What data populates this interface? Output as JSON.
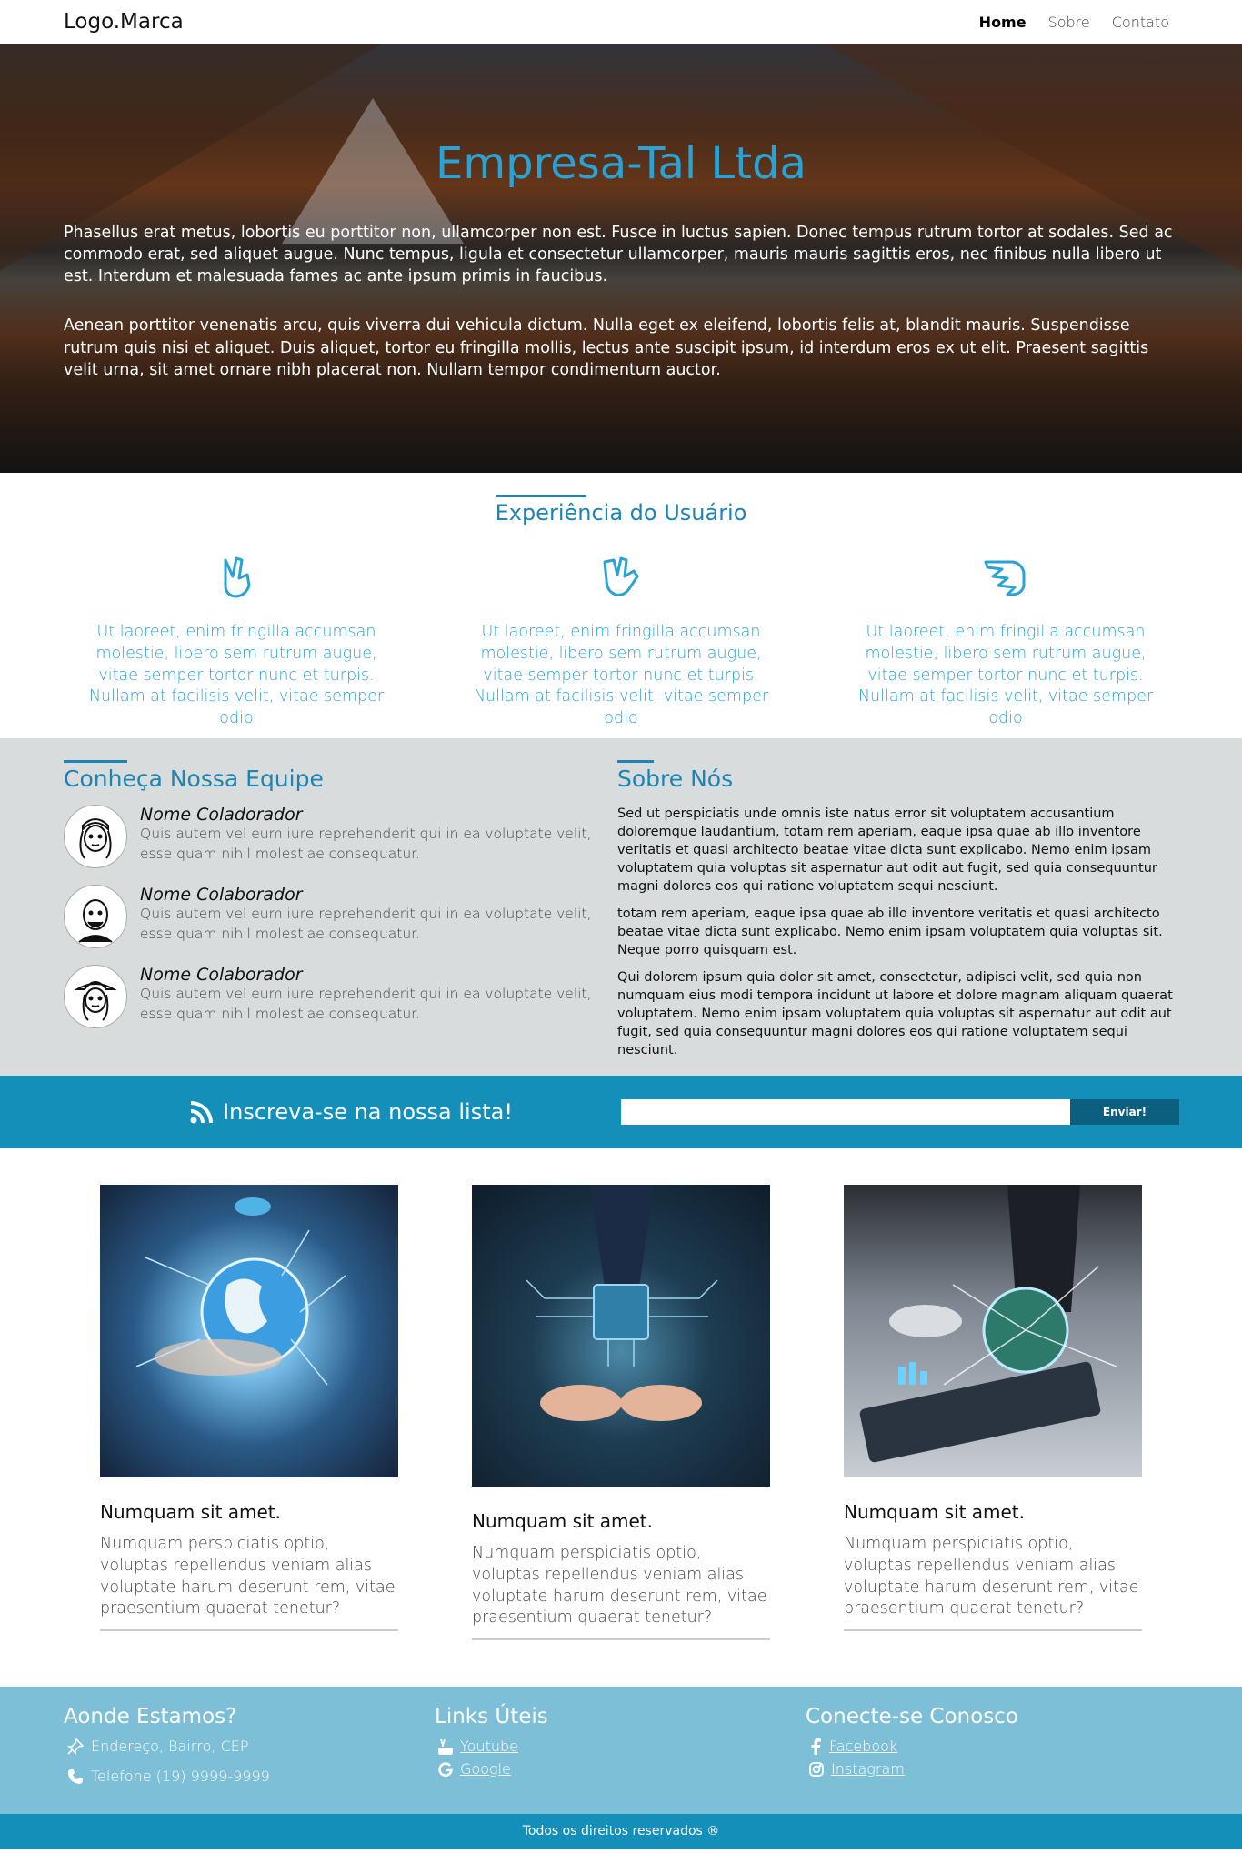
{
  "nav": {
    "logo": "Logo.Marca",
    "items": [
      {
        "label": "Home",
        "active": true
      },
      {
        "label": "Sobre",
        "active": false
      },
      {
        "label": "Contato",
        "active": false
      }
    ]
  },
  "hero": {
    "title": "Empresa-Tal Ltda",
    "paragraphs": [
      "Phasellus erat metus, lobortis eu porttitor non, ullamcorper non est. Fusce in luctus sapien. Donec tempus rutrum tortor at sodales. Sed ac commodo erat, sed aliquet augue. Nunc tempus, ligula et consectetur ullamcorper, mauris mauris sagittis eros, nec finibus nulla libero ut est. Interdum et malesuada fames ac ante ipsum primis in faucibus.",
      "Aenean porttitor venenatis arcu, quis viverra dui vehicula dictum. Nulla eget ex eleifend, lobortis felis at, blandit mauris. Suspendisse rutrum quis nisi et aliquet. Duis aliquet, tortor eu fringilla mollis, lectus ante suscipit ipsum, id interdum eros ex ut elit. Praesent sagittis velit urna, sit amet ornare nibh placerat non. Nullam tempor condimentum auctor."
    ]
  },
  "experience": {
    "title": "Experiência do Usuário",
    "columns": [
      {
        "icon": "peace-hand-icon",
        "text": "Ut laoreet, enim fringilla accumsan molestie, libero sem rutrum augue, vitae semper tortor nunc et turpis. Nullam at facilisis velit, vitae semper odio"
      },
      {
        "icon": "spock-hand-icon",
        "text": "Ut laoreet, enim fringilla accumsan molestie, libero sem rutrum augue, vitae semper tortor nunc et turpis. Nullam at facilisis velit, vitae semper odio"
      },
      {
        "icon": "pointing-hand-icon",
        "text": "Ut laoreet, enim fringilla accumsan molestie, libero sem rutrum augue, vitae semper tortor nunc et turpis. Nullam at facilisis velit, vitae semper odio"
      }
    ]
  },
  "team": {
    "title": "Conheça Nossa Equipe",
    "members": [
      {
        "name": "Nome Coladorador",
        "desc": "Quis autem vel eum iure reprehenderit qui in ea voluptate velit, esse quam nihil molestiae consequatur."
      },
      {
        "name": "Nome Colaborador",
        "desc": "Quis autem vel eum iure reprehenderit qui in ea voluptate velit, esse quam nihil molestiae consequatur."
      },
      {
        "name": "Nome Colaborador",
        "desc": "Quis autem vel eum iure reprehenderit qui in ea voluptate velit, esse quam nihil molestiae consequatur."
      }
    ]
  },
  "about": {
    "title": "Sobre Nós",
    "paragraphs": [
      "Sed ut perspiciatis unde omnis iste natus error sit voluptatem accusantium doloremque laudantium, totam rem aperiam, eaque ipsa quae ab illo inventore veritatis et quasi architecto beatae vitae dicta sunt explicabo. Nemo enim ipsam voluptatem quia voluptas sit aspernatur aut odit aut fugit, sed quia consequuntur magni dolores eos qui ratione voluptatem sequi nesciunt.",
      "totam rem aperiam, eaque ipsa quae ab illo inventore veritatis et quasi architecto beatae vitae dicta sunt explicabo. Nemo enim ipsam voluptatem quia voluptas sit. Neque porro quisquam est.",
      "Qui dolorem ipsum quia dolor sit amet, consectetur, adipisci velit, sed quia non numquam eius modi tempora incidunt ut labore et dolore magnam aliquam quaerat voluptatem. Nemo enim ipsam voluptatem quia voluptas sit aspernatur aut odit aut fugit, sed quia consequuntur magni dolores eos qui ratione voluptatem sequi nesciunt."
    ]
  },
  "subscribe": {
    "label": "Inscreva-se na nossa lista!",
    "input_value": "",
    "button": "Enviar!"
  },
  "cards": [
    {
      "title": "Numquam sit amet.",
      "text": "Numquam perspiciatis optio, voluptas repellendus veniam alias voluptate harum deserunt rem, vitae praesentium quaerat tenetur?"
    },
    {
      "title": "Numquam sit amet.",
      "text": "Numquam perspiciatis optio, voluptas repellendus veniam alias voluptate harum deserunt rem, vitae praesentium quaerat tenetur?"
    },
    {
      "title": "Numquam sit amet.",
      "text": "Numquam perspiciatis optio, voluptas repellendus veniam alias voluptate harum deserunt rem, vitae praesentium quaerat tenetur?"
    }
  ],
  "footer": {
    "location": {
      "title": "Aonde Estamos?",
      "address": "Endereço, Bairro, CEP",
      "phone": "Telefone (19) 9999-9999"
    },
    "links": {
      "title": "Links Úteis",
      "items": [
        "Youtube",
        "Google"
      ]
    },
    "social": {
      "title": "Conecte-se Conosco",
      "items": [
        "Facebook",
        "Instagram"
      ]
    },
    "copyright": "Todos os direitos reservados ®"
  },
  "colors": {
    "accent": "#1d84b3",
    "subscribe_bg": "#138fba",
    "footer_bg": "#7cbfd6",
    "light_section_bg": "#d8dcdd"
  }
}
